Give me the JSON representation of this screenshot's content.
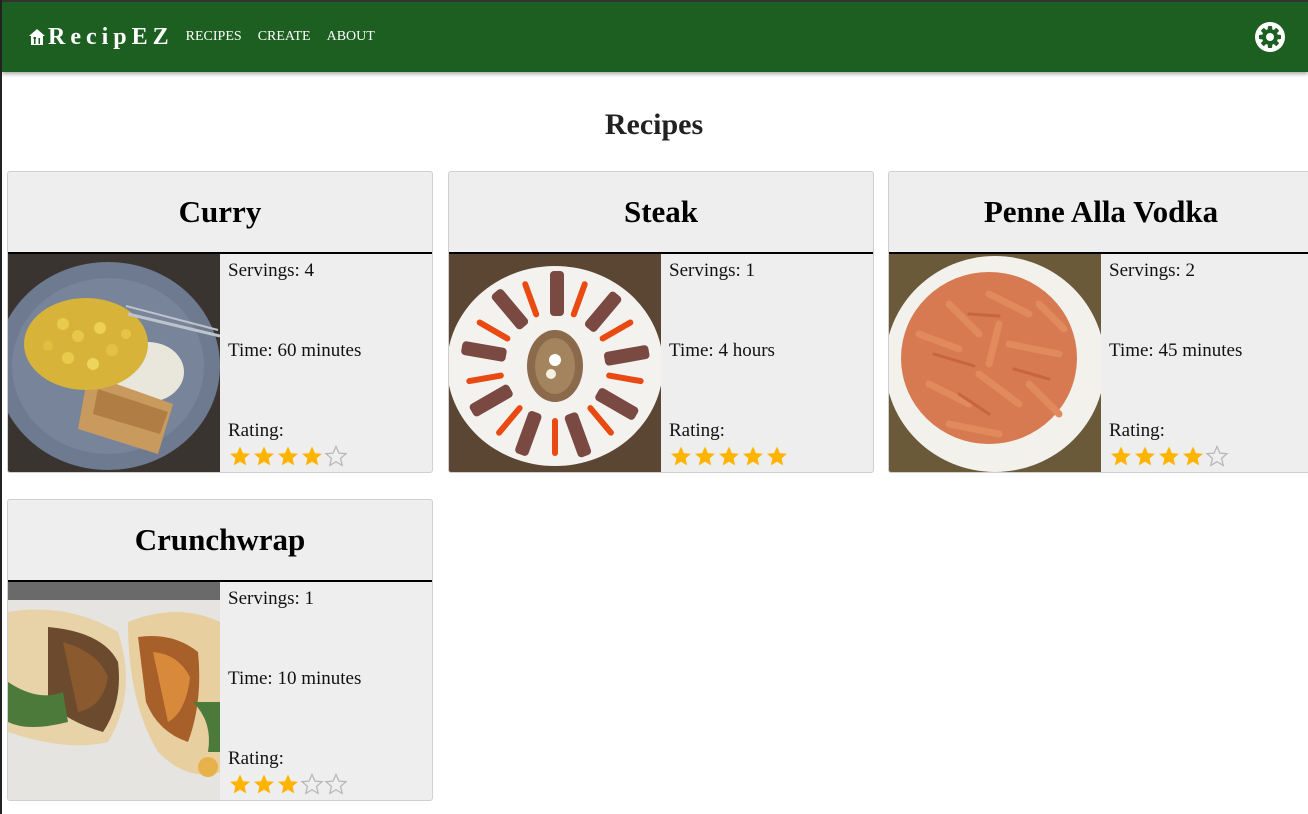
{
  "app": {
    "brand": "RecipEZ",
    "nav": [
      "RECIPES",
      "CREATE",
      "ABOUT"
    ]
  },
  "page": {
    "title": "Recipes"
  },
  "labels": {
    "rating": "Rating:"
  },
  "colors": {
    "appbar": "#1d5e21",
    "star_filled": "#ffb400",
    "star_empty": "#b8b8b8",
    "card_bg": "#eeeeee"
  },
  "recipes": [
    {
      "title": "Curry",
      "servings": "Servings: 4",
      "time": "Time: 60 minutes",
      "rating": 4,
      "image": "curry-photo"
    },
    {
      "title": "Steak",
      "servings": "Servings: 1",
      "time": "Time: 4 hours",
      "rating": 5,
      "image": "steak-photo"
    },
    {
      "title": "Penne Alla Vodka",
      "servings": "Servings: 2",
      "time": "Time: 45 minutes",
      "rating": 4,
      "image": "penne-photo"
    },
    {
      "title": "Crunchwrap",
      "servings": "Servings: 1",
      "time": "Time: 10 minutes",
      "rating": 3,
      "image": "crunchwrap-photo"
    }
  ]
}
